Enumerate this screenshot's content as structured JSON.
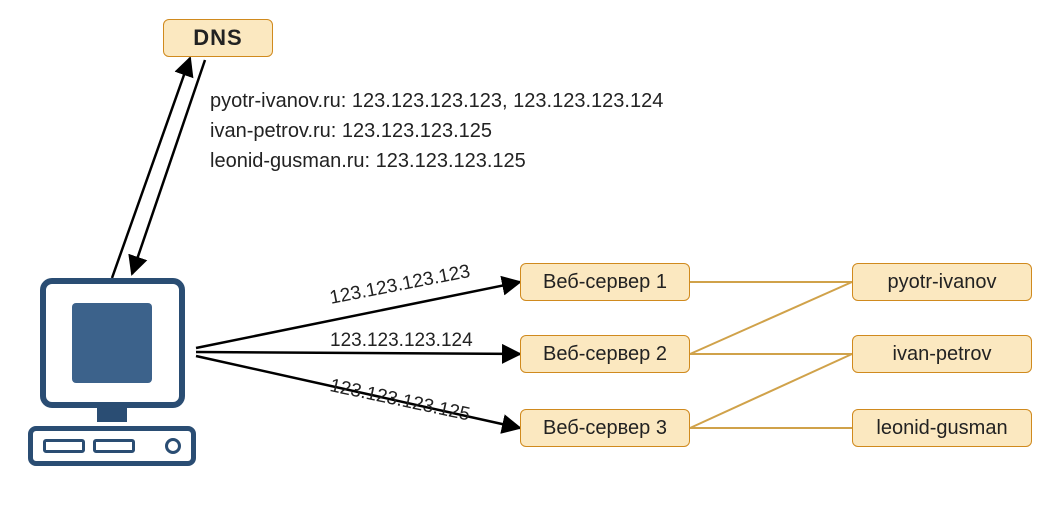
{
  "dns": {
    "label": "DNS"
  },
  "records": [
    "pyotr-ivanov.ru: 123.123.123.123, 123.123.123.124",
    "ivan-petrov.ru: 123.123.123.125",
    "leonid-gusman.ru: 123.123.123.125"
  ],
  "ip_labels": {
    "ip1": "123.123.123.123",
    "ip2": "123.123.123.124",
    "ip3": "123.123.123.125"
  },
  "servers": {
    "s1": "Веб-сервер 1",
    "s2": "Веб-сервер 2",
    "s3": "Веб-сервер 3"
  },
  "sites": {
    "site1": "pyotr-ivanov",
    "site2": "ivan-petrov",
    "site3": "leonid-gusman"
  }
}
